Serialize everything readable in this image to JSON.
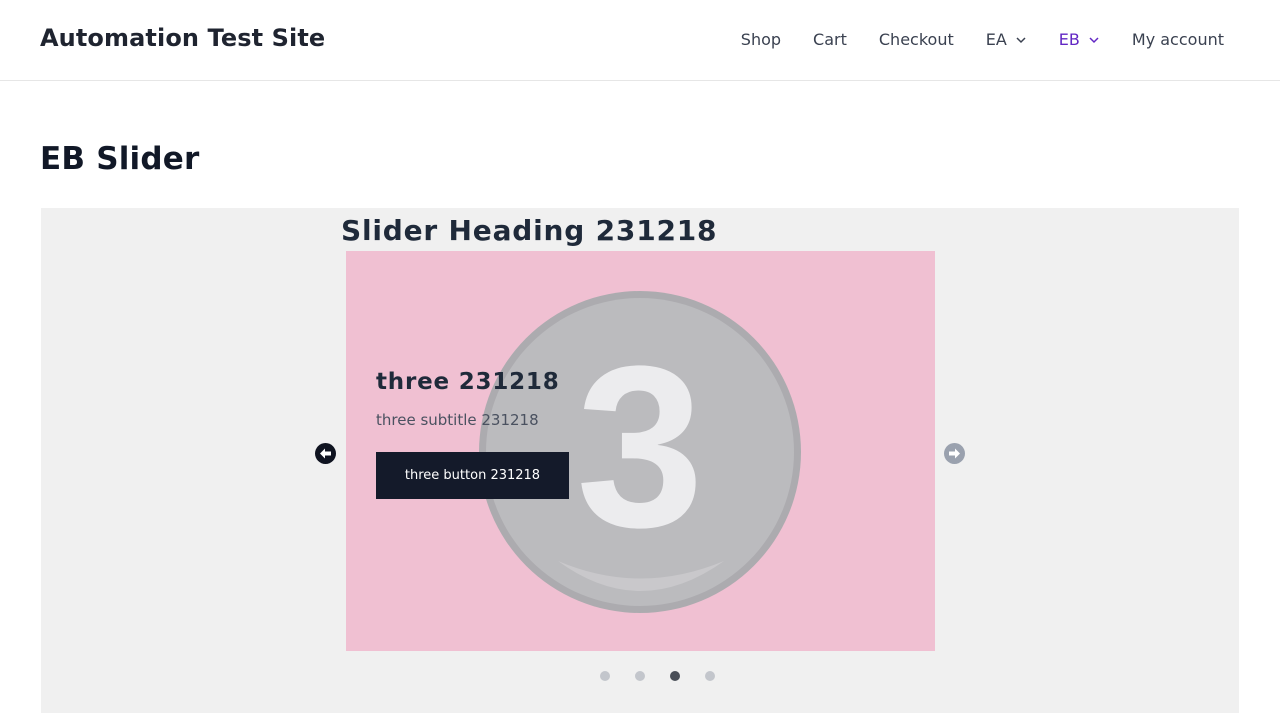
{
  "site": {
    "title": "Automation Test Site"
  },
  "nav": {
    "items": [
      {
        "label": "Shop"
      },
      {
        "label": "Cart"
      },
      {
        "label": "Checkout"
      },
      {
        "label": "EA"
      },
      {
        "label": "EB"
      },
      {
        "label": "My account"
      }
    ],
    "active": "EB"
  },
  "page": {
    "title": "EB Slider"
  },
  "slider": {
    "heading": "Slider Heading 231218",
    "current_slide": 3,
    "total_slides": 4,
    "slide": {
      "image_number": "3",
      "title": "three 231218",
      "subtitle": "three subtitle 231218",
      "button_label": "three button 231218",
      "background_color": "#f0c0d2"
    }
  },
  "colors": {
    "accent": "#6227c4",
    "button_bg": "#141a2a",
    "slider_bg": "#f0f0f0"
  }
}
